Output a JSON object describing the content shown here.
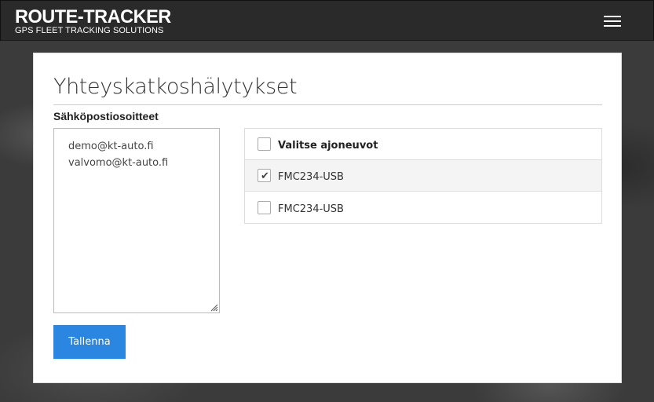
{
  "header": {
    "brand_title": "ROUTE-TRACKER",
    "brand_subtitle": "GPS FLEET TRACKING SOLUTIONS",
    "menu_icon": "hamburger-menu-icon"
  },
  "page": {
    "title": "Yhteyskatkoshälytykset",
    "emails_label": "Sähköpostiosoitteet",
    "emails": [
      "demo@kt-auto.fi",
      "valvomo@kt-auto.fi"
    ],
    "save_label": "Tallenna"
  },
  "vehicles": {
    "select_all_label": "Valitse ajoneuvot",
    "select_all_checked": false,
    "items": [
      {
        "label": "FMC234-USB",
        "checked": true
      },
      {
        "label": "FMC234-USB",
        "checked": false
      }
    ]
  },
  "colors": {
    "accent": "#2a86e0",
    "navbar": "#2a2a2a"
  }
}
